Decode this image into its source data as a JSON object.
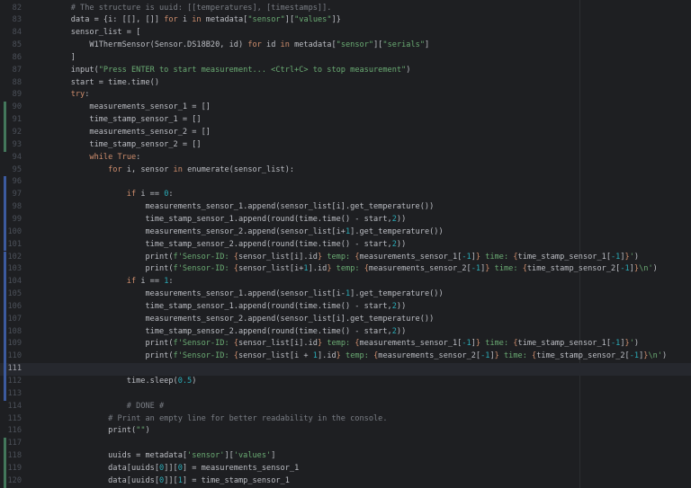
{
  "editor": {
    "lines": [
      {
        "num": "82",
        "mark": "",
        "segs": [
          {
            "t": "    "
          },
          {
            "t": "# The structure is uuid: [[temperatures], [timestamps]].",
            "c": "c"
          }
        ]
      },
      {
        "num": "83",
        "mark": "",
        "segs": [
          {
            "t": "    data = {i: [[], []] "
          },
          {
            "t": "for",
            "c": "k"
          },
          {
            "t": " i "
          },
          {
            "t": "in",
            "c": "k"
          },
          {
            "t": " metadata["
          },
          {
            "t": "\"sensor\"",
            "c": "s"
          },
          {
            "t": "]["
          },
          {
            "t": "\"values\"",
            "c": "s"
          },
          {
            "t": "]}"
          }
        ]
      },
      {
        "num": "84",
        "mark": "",
        "segs": [
          {
            "t": "    sensor_list = ["
          }
        ]
      },
      {
        "num": "85",
        "mark": "",
        "segs": [
          {
            "t": "        W1ThermSensor(Sensor.DS18B20, id) "
          },
          {
            "t": "for",
            "c": "k"
          },
          {
            "t": " id "
          },
          {
            "t": "in",
            "c": "k"
          },
          {
            "t": " metadata["
          },
          {
            "t": "\"sensor\"",
            "c": "s"
          },
          {
            "t": "]["
          },
          {
            "t": "\"serials\"",
            "c": "s"
          },
          {
            "t": "]"
          }
        ]
      },
      {
        "num": "86",
        "mark": "",
        "segs": [
          {
            "t": "    ]"
          }
        ]
      },
      {
        "num": "87",
        "mark": "",
        "segs": [
          {
            "t": "    input("
          },
          {
            "t": "\"Press ENTER to start measurement... <Ctrl+C> to stop measurement\"",
            "c": "s"
          },
          {
            "t": ")"
          }
        ]
      },
      {
        "num": "88",
        "mark": "",
        "segs": [
          {
            "t": "    start = time.time()"
          }
        ]
      },
      {
        "num": "89",
        "mark": "",
        "segs": [
          {
            "t": "    "
          },
          {
            "t": "try",
            "c": "k"
          },
          {
            "t": ":"
          }
        ]
      },
      {
        "num": "90",
        "mark": "added",
        "segs": [
          {
            "t": "        measurements_sensor_1 = []"
          }
        ]
      },
      {
        "num": "91",
        "mark": "added",
        "segs": [
          {
            "t": "        time_stamp_sensor_1 = []"
          }
        ]
      },
      {
        "num": "92",
        "mark": "added",
        "segs": [
          {
            "t": "        measurements_sensor_2 = []"
          }
        ]
      },
      {
        "num": "93",
        "mark": "added",
        "segs": [
          {
            "t": "        time_stamp_sensor_2 = []"
          }
        ]
      },
      {
        "num": "94",
        "mark": "",
        "segs": [
          {
            "t": "        "
          },
          {
            "t": "while",
            "c": "k"
          },
          {
            "t": " "
          },
          {
            "t": "True",
            "c": "k"
          },
          {
            "t": ":"
          }
        ]
      },
      {
        "num": "95",
        "mark": "",
        "segs": [
          {
            "t": "            "
          },
          {
            "t": "for",
            "c": "k"
          },
          {
            "t": " i, sensor "
          },
          {
            "t": "in",
            "c": "k"
          },
          {
            "t": " enumerate(sensor_list):"
          }
        ]
      },
      {
        "num": "96",
        "mark": "modified",
        "segs": [
          {
            "t": ""
          }
        ]
      },
      {
        "num": "97",
        "mark": "modified",
        "segs": [
          {
            "t": "                "
          },
          {
            "t": "if",
            "c": "k"
          },
          {
            "t": " i == "
          },
          {
            "t": "0",
            "c": "n"
          },
          {
            "t": ":"
          }
        ]
      },
      {
        "num": "98",
        "mark": "modified",
        "segs": [
          {
            "t": "                    measurements_sensor_1.append(sensor_list[i].get_temperature())"
          }
        ]
      },
      {
        "num": "99",
        "mark": "modified",
        "segs": [
          {
            "t": "                    time_stamp_sensor_1.append(round(time.time() - start,"
          },
          {
            "t": "2",
            "c": "n"
          },
          {
            "t": "))"
          }
        ]
      },
      {
        "num": "100",
        "mark": "modified",
        "segs": [
          {
            "t": "                    measurements_sensor_2.append(sensor_list[i+"
          },
          {
            "t": "1",
            "c": "n"
          },
          {
            "t": "].get_temperature())"
          }
        ]
      },
      {
        "num": "101",
        "mark": "modified",
        "segs": [
          {
            "t": "                    time_stamp_sensor_2.append(round(time.time() - start,"
          },
          {
            "t": "2",
            "c": "n"
          },
          {
            "t": "))"
          }
        ]
      },
      {
        "num": "102",
        "mark": "modified",
        "segs": [
          {
            "t": "                    print("
          },
          {
            "t": "f'Sensor-ID: ",
            "c": "s"
          },
          {
            "t": "{",
            "c": "e"
          },
          {
            "t": "sensor_list[i].id"
          },
          {
            "t": "}",
            "c": "e"
          },
          {
            "t": " temp: ",
            "c": "s"
          },
          {
            "t": "{",
            "c": "e"
          },
          {
            "t": "measurements_sensor_1["
          },
          {
            "t": "-1",
            "c": "n"
          },
          {
            "t": "]"
          },
          {
            "t": "}",
            "c": "e"
          },
          {
            "t": " time: ",
            "c": "s"
          },
          {
            "t": "{",
            "c": "e"
          },
          {
            "t": "time_stamp_sensor_1["
          },
          {
            "t": "-1",
            "c": "n"
          },
          {
            "t": "]"
          },
          {
            "t": "}",
            "c": "e"
          },
          {
            "t": "'",
            "c": "s"
          },
          {
            "t": ")"
          }
        ]
      },
      {
        "num": "103",
        "mark": "modified",
        "segs": [
          {
            "t": "                    print("
          },
          {
            "t": "f'Sensor-ID: ",
            "c": "s"
          },
          {
            "t": "{",
            "c": "e"
          },
          {
            "t": "sensor_list[i+"
          },
          {
            "t": "1",
            "c": "n"
          },
          {
            "t": "].id"
          },
          {
            "t": "}",
            "c": "e"
          },
          {
            "t": " temp: ",
            "c": "s"
          },
          {
            "t": "{",
            "c": "e"
          },
          {
            "t": "measurements_sensor_2["
          },
          {
            "t": "-1",
            "c": "n"
          },
          {
            "t": "]"
          },
          {
            "t": "}",
            "c": "e"
          },
          {
            "t": " time: ",
            "c": "s"
          },
          {
            "t": "{",
            "c": "e"
          },
          {
            "t": "time_stamp_sensor_2["
          },
          {
            "t": "-1",
            "c": "n"
          },
          {
            "t": "]"
          },
          {
            "t": "}",
            "c": "e"
          },
          {
            "t": "\\n'",
            "c": "s"
          },
          {
            "t": ")"
          }
        ]
      },
      {
        "num": "104",
        "mark": "modified",
        "segs": [
          {
            "t": "                "
          },
          {
            "t": "if",
            "c": "k"
          },
          {
            "t": " i == "
          },
          {
            "t": "1",
            "c": "n"
          },
          {
            "t": ":"
          }
        ]
      },
      {
        "num": "105",
        "mark": "modified",
        "segs": [
          {
            "t": "                    measurements_sensor_1.append(sensor_list[i-"
          },
          {
            "t": "1",
            "c": "n"
          },
          {
            "t": "].get_temperature())"
          }
        ]
      },
      {
        "num": "106",
        "mark": "modified",
        "segs": [
          {
            "t": "                    time_stamp_sensor_1.append(round(time.time() - start,"
          },
          {
            "t": "2",
            "c": "n"
          },
          {
            "t": "))"
          }
        ]
      },
      {
        "num": "107",
        "mark": "modified",
        "segs": [
          {
            "t": "                    measurements_sensor_2.append(sensor_list[i].get_temperature())"
          }
        ]
      },
      {
        "num": "108",
        "mark": "modified",
        "segs": [
          {
            "t": "                    time_stamp_sensor_2.append(round(time.time() - start,"
          },
          {
            "t": "2",
            "c": "n"
          },
          {
            "t": "))"
          }
        ]
      },
      {
        "num": "109",
        "mark": "modified",
        "segs": [
          {
            "t": "                    print("
          },
          {
            "t": "f'Sensor-ID: ",
            "c": "s"
          },
          {
            "t": "{",
            "c": "e"
          },
          {
            "t": "sensor_list[i].id"
          },
          {
            "t": "}",
            "c": "e"
          },
          {
            "t": " temp: ",
            "c": "s"
          },
          {
            "t": "{",
            "c": "e"
          },
          {
            "t": "measurements_sensor_1["
          },
          {
            "t": "-1",
            "c": "n"
          },
          {
            "t": "]"
          },
          {
            "t": "}",
            "c": "e"
          },
          {
            "t": " time: ",
            "c": "s"
          },
          {
            "t": "{",
            "c": "e"
          },
          {
            "t": "time_stamp_sensor_1["
          },
          {
            "t": "-1",
            "c": "n"
          },
          {
            "t": "]"
          },
          {
            "t": "}",
            "c": "e"
          },
          {
            "t": "'",
            "c": "s"
          },
          {
            "t": ")"
          }
        ]
      },
      {
        "num": "110",
        "mark": "modified",
        "segs": [
          {
            "t": "                    print("
          },
          {
            "t": "f'Sensor-ID: ",
            "c": "s"
          },
          {
            "t": "{",
            "c": "e"
          },
          {
            "t": "sensor_list[i + "
          },
          {
            "t": "1",
            "c": "n"
          },
          {
            "t": "].id"
          },
          {
            "t": "}",
            "c": "e"
          },
          {
            "t": " temp: ",
            "c": "s"
          },
          {
            "t": "{",
            "c": "e"
          },
          {
            "t": "measurements_sensor_2["
          },
          {
            "t": "-1",
            "c": "n"
          },
          {
            "t": "]"
          },
          {
            "t": "}",
            "c": "e"
          },
          {
            "t": " time: ",
            "c": "s"
          },
          {
            "t": "{",
            "c": "e"
          },
          {
            "t": "time_stamp_sensor_2["
          },
          {
            "t": "-1",
            "c": "n"
          },
          {
            "t": "]"
          },
          {
            "t": "}",
            "c": "e"
          },
          {
            "t": "\\n'",
            "c": "s"
          },
          {
            "t": ")"
          }
        ]
      },
      {
        "num": "111",
        "mark": "modified",
        "current": true,
        "segs": [
          {
            "t": ""
          }
        ]
      },
      {
        "num": "112",
        "mark": "modified",
        "segs": [
          {
            "t": "                time.sleep("
          },
          {
            "t": "0.5",
            "c": "n"
          },
          {
            "t": ")"
          }
        ]
      },
      {
        "num": "113",
        "mark": "modified",
        "segs": [
          {
            "t": ""
          }
        ]
      },
      {
        "num": "114",
        "mark": "",
        "segs": [
          {
            "t": "                "
          },
          {
            "t": "# DONE #",
            "c": "c"
          }
        ]
      },
      {
        "num": "115",
        "mark": "",
        "segs": [
          {
            "t": "            "
          },
          {
            "t": "# Print an empty line for better readability in the console.",
            "c": "c"
          }
        ]
      },
      {
        "num": "116",
        "mark": "",
        "segs": [
          {
            "t": "            print("
          },
          {
            "t": "\"\"",
            "c": "s"
          },
          {
            "t": ")"
          }
        ]
      },
      {
        "num": "117",
        "mark": "added",
        "segs": [
          {
            "t": ""
          }
        ]
      },
      {
        "num": "118",
        "mark": "added",
        "segs": [
          {
            "t": "            uuids = metadata["
          },
          {
            "t": "'sensor'",
            "c": "s"
          },
          {
            "t": "]["
          },
          {
            "t": "'values'",
            "c": "s"
          },
          {
            "t": "]"
          }
        ]
      },
      {
        "num": "119",
        "mark": "added",
        "segs": [
          {
            "t": "            data[uuids["
          },
          {
            "t": "0",
            "c": "n"
          },
          {
            "t": "]]["
          },
          {
            "t": "0",
            "c": "n"
          },
          {
            "t": "] = measurements_sensor_1"
          }
        ]
      },
      {
        "num": "120",
        "mark": "added",
        "segs": [
          {
            "t": "            data[uuids["
          },
          {
            "t": "0",
            "c": "n"
          },
          {
            "t": "]]["
          },
          {
            "t": "1",
            "c": "n"
          },
          {
            "t": "] = time_stamp_sensor_1"
          }
        ]
      }
    ]
  }
}
